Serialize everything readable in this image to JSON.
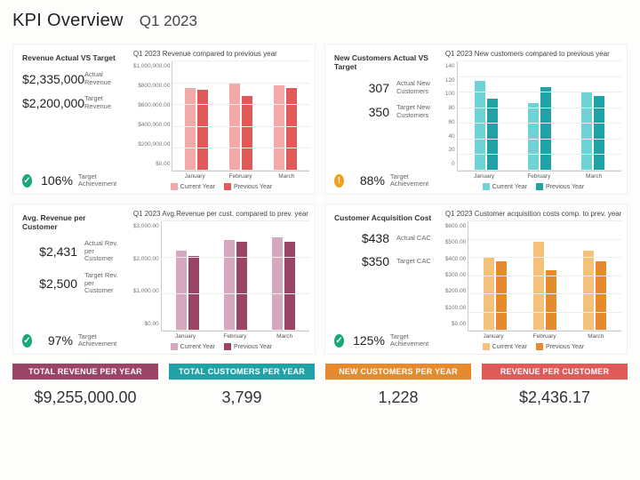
{
  "header": {
    "title": "KPI Overview",
    "period": "Q1 2023"
  },
  "cards": [
    {
      "title": "Revenue Actual VS Target",
      "actual_val": "$2,335,000",
      "actual_lbl": "Actual Revenue",
      "target_val": "$2,200,000",
      "target_lbl": "Target Revenue",
      "ach_pct": "106%",
      "ach_lbl": "Target Achievement",
      "ach_status": "ok",
      "chart_title": "Q1 2023  Revenue compared to previous year",
      "colors": {
        "cy": "#f3a9a7",
        "py": "#e05a5a"
      }
    },
    {
      "title": "New Customers Actual VS Target",
      "actual_val": "307",
      "actual_lbl": "Actual New Customers",
      "target_val": "350",
      "target_lbl": "Target New Customers",
      "ach_pct": "88%",
      "ach_lbl": "Target Achievement",
      "ach_status": "warn",
      "chart_title": "Q1 2023  New customers compared to previous year",
      "colors": {
        "cy": "#6fd3d6",
        "py": "#1fa3a6"
      }
    },
    {
      "title": "Avg. Revenue per Customer",
      "actual_val": "$2,431",
      "actual_lbl": "Actual Rev. per Customer",
      "target_val": "$2,500",
      "target_lbl": "Target Rev. per Customer",
      "ach_pct": "97%",
      "ach_lbl": "Target Achievement",
      "ach_status": "ok",
      "chart_title": "Q1 2023  Avg.Revenue per cust. compared to prev. year",
      "colors": {
        "cy": "#d6a8bf",
        "py": "#9a4565"
      }
    },
    {
      "title": "Customer Acquisition Cost",
      "actual_val": "$438",
      "actual_lbl": "Actual CAC",
      "target_val": "$350",
      "target_lbl": "Target CAC",
      "ach_pct": "125%",
      "ach_lbl": "Target Achievement",
      "ach_status": "ok",
      "chart_title": "Q1 2023  Customer acquisition costs comp. to prev. year",
      "colors": {
        "cy": "#f4c27a",
        "py": "#e68a2e"
      }
    }
  ],
  "legend": {
    "cy": "Current Year",
    "py": "Previous Year"
  },
  "footer": [
    {
      "label": "TOTAL REVENUE PER YEAR",
      "value": "$9,255,000.00",
      "color": "#9a4565"
    },
    {
      "label": "TOTAL CUSTOMERS PER YEAR",
      "value": "3,799",
      "color": "#1fa3a6"
    },
    {
      "label": "NEW CUSTOMERS PER YEAR",
      "value": "1,228",
      "color": "#e68a2e"
    },
    {
      "label": "REVENUE PER CUSTOMER",
      "value": "$2,436.17",
      "color": "#e05a5a"
    }
  ],
  "chart_data": [
    {
      "title": "Revenue compared to previous year",
      "type": "bar",
      "categories": [
        "January",
        "February",
        "March"
      ],
      "y_ticks": [
        "$1,000,000.00",
        "$800,000.00",
        "$600,000.00",
        "$400,000.00",
        "$200,000.00",
        "$0.00"
      ],
      "ylim": [
        0,
        1000000
      ],
      "series": [
        {
          "name": "Current Year",
          "values": [
            760000,
            800000,
            780000
          ]
        },
        {
          "name": "Previous Year",
          "values": [
            740000,
            680000,
            760000
          ]
        }
      ]
    },
    {
      "title": "New customers compared to previous year",
      "type": "bar",
      "categories": [
        "January",
        "February",
        "March"
      ],
      "y_ticks": [
        "140",
        "120",
        "100",
        "80",
        "60",
        "40",
        "20",
        "0"
      ],
      "ylim": [
        0,
        140
      ],
      "series": [
        {
          "name": "Current Year",
          "values": [
            115,
            86,
            100
          ]
        },
        {
          "name": "Previous Year",
          "values": [
            92,
            107,
            96
          ]
        }
      ]
    },
    {
      "title": "Avg.Revenue per cust. compared to prev. year",
      "type": "bar",
      "categories": [
        "January",
        "February",
        "March"
      ],
      "y_ticks": [
        "$3,000.00",
        "$2,000.00",
        "$1,000.00",
        "$0.00"
      ],
      "ylim": [
        0,
        3000
      ],
      "series": [
        {
          "name": "Current Year",
          "values": [
            2200,
            2500,
            2550
          ]
        },
        {
          "name": "Previous Year",
          "values": [
            2050,
            2450,
            2450
          ]
        }
      ]
    },
    {
      "title": "Customer acquisition costs comp. to prev. year",
      "type": "bar",
      "categories": [
        "January",
        "February",
        "March"
      ],
      "y_ticks": [
        "$600.00",
        "$500.00",
        "$400.00",
        "$300.00",
        "$200.00",
        "$100.00",
        "$0.00"
      ],
      "ylim": [
        0,
        600
      ],
      "series": [
        {
          "name": "Current Year",
          "values": [
            400,
            490,
            440
          ]
        },
        {
          "name": "Previous Year",
          "values": [
            380,
            330,
            380
          ]
        }
      ]
    }
  ]
}
